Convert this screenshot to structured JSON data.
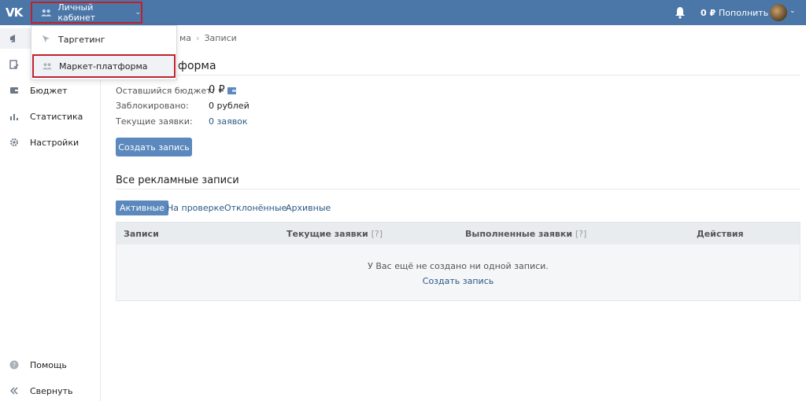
{
  "header": {
    "logo": "VK",
    "cabinet_label": "Личный кабинет",
    "balance": "0 ₽",
    "topup_label": "Пополнить"
  },
  "dropdown": {
    "items": [
      {
        "label": "Таргетинг"
      },
      {
        "label": "Маркет-платформа"
      }
    ]
  },
  "sidebar": {
    "items": [
      {
        "label": "Бюджет"
      },
      {
        "label": "Статистика"
      },
      {
        "label": "Настройки"
      }
    ],
    "help_label": "Помощь",
    "collapse_label": "Свернуть"
  },
  "breadcrumb": {
    "part1": "ма",
    "part2": "Записи"
  },
  "page": {
    "title": "форма"
  },
  "info": {
    "budget_label": "Оставшийся бюджет:",
    "budget_value": "0 ₽",
    "blocked_label": "Заблокировано:",
    "blocked_value": "0 рублей",
    "requests_label": "Текущие заявки:",
    "requests_value": "0 заявок"
  },
  "actions": {
    "create_label": "Создать запись"
  },
  "section": {
    "title": "Все рекламные записи"
  },
  "tabs": [
    {
      "label": "Активные"
    },
    {
      "label": "На проверке"
    },
    {
      "label": "Отклонённые"
    },
    {
      "label": "Архивные"
    }
  ],
  "table": {
    "columns": [
      "Записи",
      "Текущие заявки",
      "Выполненные заявки",
      "Действия"
    ],
    "hint": "[?]",
    "empty_message": "У Вас ещё не создано ни одной записи.",
    "empty_link": "Создать запись"
  },
  "colors": {
    "header_bg": "#4a76a8",
    "accent": "#5b88bd",
    "highlight_border": "#c0222c",
    "link": "#2a5885"
  }
}
